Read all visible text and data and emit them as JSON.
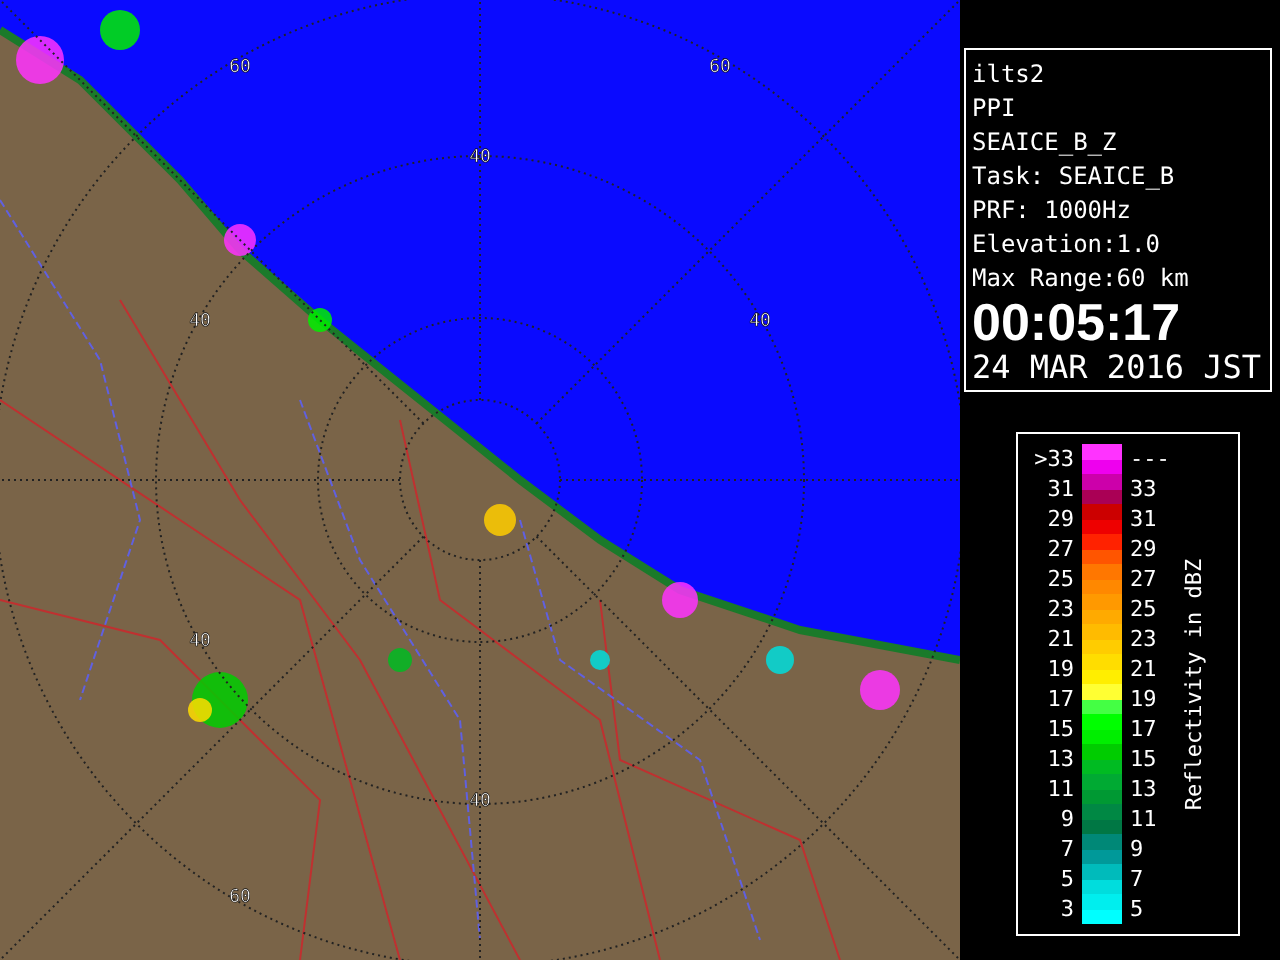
{
  "map": {
    "range_labels": [
      "60",
      "60",
      "40",
      "40",
      "40",
      "40",
      "40",
      "60"
    ]
  },
  "info": {
    "lines": [
      "ilts2",
      "PPI",
      "SEAICE_B_Z",
      "Task: SEAICE_B",
      "PRF: 1000Hz",
      "Elevation:1.0",
      "Max Range:60 km"
    ],
    "time": "00:05:17",
    "date": "24 MAR 2016 JST"
  },
  "legend": {
    "title": "Reflectivity in dBZ",
    "rows": [
      {
        "low": ">33",
        "high": "---",
        "swatches": [
          {
            "color": "#ff33ff"
          },
          {
            "color": "#ee00ee"
          }
        ]
      },
      {
        "low": "31",
        "high": "33",
        "swatches": [
          {
            "color": "#cc00aa"
          },
          {
            "color": "#aa0055"
          }
        ]
      },
      {
        "low": "29",
        "high": "31",
        "swatches": [
          {
            "color": "#cc0000"
          },
          {
            "color": "#ee0000"
          }
        ]
      },
      {
        "low": "27",
        "high": "29",
        "swatches": [
          {
            "color": "#ff2200"
          },
          {
            "color": "#ff5500"
          }
        ]
      },
      {
        "low": "25",
        "high": "27",
        "swatches": [
          {
            "color": "#ff7700"
          },
          {
            "color": "#ff8800"
          }
        ]
      },
      {
        "low": "23",
        "high": "25",
        "swatches": [
          {
            "color": "#ff9900"
          },
          {
            "color": "#ffaa00"
          }
        ]
      },
      {
        "low": "21",
        "high": "23",
        "swatches": [
          {
            "color": "#ffbb00"
          },
          {
            "color": "#ffcc00"
          }
        ]
      },
      {
        "low": "19",
        "high": "21",
        "swatches": [
          {
            "color": "#ffdd00"
          },
          {
            "color": "#ffee00"
          }
        ]
      },
      {
        "low": "17",
        "high": "19",
        "swatches": [
          {
            "color": "#ffff33"
          },
          {
            "color": "#44ff44"
          }
        ]
      },
      {
        "low": "15",
        "high": "17",
        "swatches": [
          {
            "color": "#00ff00"
          },
          {
            "color": "#00ee00"
          }
        ]
      },
      {
        "low": "13",
        "high": "15",
        "swatches": [
          {
            "color": "#00cc00"
          },
          {
            "color": "#00bb22"
          }
        ]
      },
      {
        "low": "11",
        "high": "13",
        "swatches": [
          {
            "color": "#00aa33"
          },
          {
            "color": "#009933"
          }
        ]
      },
      {
        "low": "9",
        "high": "11",
        "swatches": [
          {
            "color": "#008844"
          },
          {
            "color": "#007744"
          }
        ]
      },
      {
        "low": "7",
        "high": "9",
        "swatches": [
          {
            "color": "#008877"
          },
          {
            "color": "#009999"
          }
        ]
      },
      {
        "low": "5",
        "high": "7",
        "swatches": [
          {
            "color": "#00bbbb"
          },
          {
            "color": "#00dddd"
          }
        ]
      },
      {
        "low": "3",
        "high": "5",
        "swatches": [
          {
            "color": "#00eeee"
          },
          {
            "color": "#00ffff"
          }
        ]
      }
    ]
  }
}
